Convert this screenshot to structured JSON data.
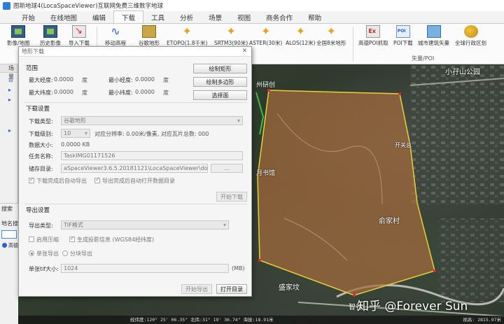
{
  "window": {
    "title": "图新地球4(LocaSpaceViewer)互联网免费三维数字地球"
  },
  "menu_tabs": [
    "开始",
    "在线地图",
    "编辑",
    "下载",
    "工具",
    "分析",
    "场景",
    "视图",
    "商务合作",
    "帮助"
  ],
  "active_tab": "下载",
  "toolbar": {
    "items": [
      {
        "label": "影像/地图",
        "icon": "screen-download-icon"
      },
      {
        "label": "历史影像",
        "icon": "history-image-icon"
      },
      {
        "label": "导入下载",
        "icon": "import-download-icon"
      },
      {
        "label": "移动高程",
        "icon": "elevation-path-icon"
      },
      {
        "label": "谷歌地形",
        "icon": "google-terrain-icon"
      },
      {
        "label": "ETOPO(1.8千米)",
        "icon": "etopo-icon"
      },
      {
        "label": "SRTM3(90米)",
        "icon": "srtm-icon"
      },
      {
        "label": "ASTER(30米)",
        "icon": "aster-icon"
      },
      {
        "label": "ALOS(12米)",
        "icon": "alos-icon"
      },
      {
        "label": "全国8米地形",
        "icon": "national-terrain-icon"
      },
      {
        "label": "高德POI抓取",
        "icon": "excel-poi-icon"
      },
      {
        "label": "POI下载",
        "icon": "poi-download-icon"
      },
      {
        "label": "城市建筑矢量",
        "icon": "building-vector-icon"
      },
      {
        "label": "全球行政区划",
        "icon": "globe-admin-icon"
      }
    ],
    "group_label": "矢量/POI"
  },
  "left_panel": {
    "header": "场景",
    "search_header": "搜索",
    "place_label": "地名搜",
    "high_label": "高德"
  },
  "dialog": {
    "title": "地形下载",
    "range": {
      "section": "范围",
      "max_lon_label": "最大经度:",
      "max_lon": "0.0000",
      "max_lon_unit": "度",
      "min_lon_label": "最小经度:",
      "min_lon": "0.0000",
      "min_lon_unit": "度",
      "max_lat_label": "最大纬度:",
      "max_lat": "0.0000",
      "max_lat_unit": "度",
      "min_lat_label": "最小纬度:",
      "min_lat": "0.0000",
      "min_lat_unit": "度",
      "btn_rect": "绘制矩形",
      "btn_poly": "绘制多边形",
      "btn_select": "选择面"
    },
    "download": {
      "section": "下载设置",
      "type_label": "下载类型:",
      "type_value": "谷歌地形",
      "level_label": "下载级别:",
      "level_value": "10",
      "level_info": "对应分辨率: 0.00米/像素, 对应瓦片总数: 000",
      "size_label": "数据大小:",
      "size_value": "0.0000 KB",
      "task_label": "任务名称:",
      "task_value": "TaskIMG01171526",
      "dir_label": "储存目录:",
      "dir_value": "aSpaceViewer3.6.5.20181121\\LocaSpaceViewer\\download",
      "browse_btn": "...",
      "auto_export": "下载完成后自动导出",
      "auto_open": "导出完成后自动打开数据目录",
      "start_btn": "开始下载"
    },
    "export": {
      "section": "导出设置",
      "type_label": "导出类型:",
      "type_value": "TIF格式",
      "compress": "启用压缩",
      "projection": "生成投影信息 (WGS84经纬度)",
      "single": "单张导出",
      "tiled": "分块导出",
      "tile_size_label": "单张tif大小:",
      "tile_size_value": "1024",
      "tile_size_unit": "(MB)",
      "export_btn": "开始导出",
      "open_btn": "打开目录"
    }
  },
  "map": {
    "labels": [
      "小孖山公园",
      "州研创",
      "月书馆",
      "俞家村",
      "盛家坟",
      "智谷",
      "开关总"
    ],
    "watermark": "知乎 @Forever Sun",
    "status_left": "经纬度:120° 25' 06.35\"  北纬:31° 19' 36.74\"  海拔:18.91米",
    "status_right": "视高: 2815.97米"
  }
}
